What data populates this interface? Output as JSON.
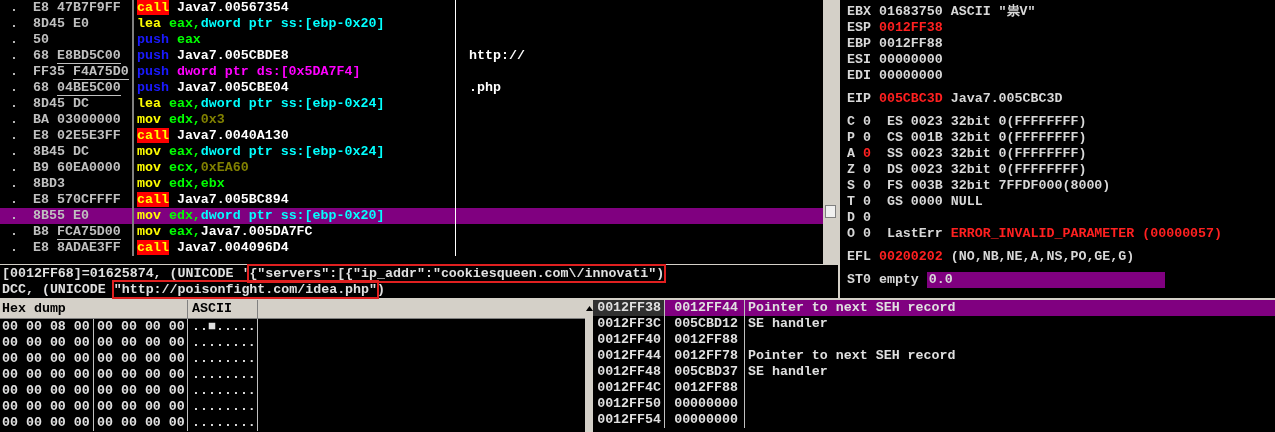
{
  "disassembly": {
    "rows": [
      {
        "marker": ".",
        "opcode": "E8",
        "operand": "47B7F9FF",
        "operand_underlined": false,
        "selected": false,
        "instruction": [
          {
            "text": "call",
            "kind": "call"
          },
          {
            "text": " Java7.00567354",
            "kind": "plain"
          }
        ]
      },
      {
        "marker": ".",
        "opcode": "8D45",
        "operand": "E0",
        "operand_underlined": false,
        "selected": false,
        "instruction": [
          {
            "text": "lea",
            "kind": "mnemonic"
          },
          {
            "text": " eax,",
            "kind": "register"
          },
          {
            "text": "dword ptr ss:[ebp-0x20]",
            "kind": "memory"
          }
        ]
      },
      {
        "marker": ".",
        "opcode": "50",
        "selected": false,
        "instruction": [
          {
            "text": "push",
            "kind": "stack"
          },
          {
            "text": " eax",
            "kind": "register"
          }
        ]
      },
      {
        "marker": ".",
        "opcode": "68",
        "operand": "E8BD5C00",
        "operand_underlined": true,
        "selected": false,
        "instruction": [
          {
            "text": "push",
            "kind": "stack"
          },
          {
            "text": " Java7.005CBDE8",
            "kind": "plain"
          }
        ],
        "comment": "http://"
      },
      {
        "marker": ".",
        "opcode": "FF35",
        "operand": "F4A75D0",
        "operand_underlined": true,
        "selected": false,
        "instruction": [
          {
            "text": "push",
            "kind": "stack"
          },
          {
            "text": " dword ptr ds:[0x5DA7F4]",
            "kind": "global"
          }
        ]
      },
      {
        "marker": ".",
        "opcode": "68",
        "operand": "04BE5C00",
        "operand_underlined": true,
        "selected": false,
        "instruction": [
          {
            "text": "push",
            "kind": "stack"
          },
          {
            "text": " Java7.005CBE04",
            "kind": "plain"
          }
        ],
        "comment": ".php"
      },
      {
        "marker": ".",
        "opcode": "8D45",
        "operand": "DC",
        "operand_underlined": false,
        "selected": false,
        "instruction": [
          {
            "text": "lea",
            "kind": "mnemonic"
          },
          {
            "text": " eax,",
            "kind": "register"
          },
          {
            "text": "dword ptr ss:[ebp-0x24]",
            "kind": "memory"
          }
        ]
      },
      {
        "marker": ".",
        "opcode": "BA",
        "operand": "03000000",
        "operand_underlined": false,
        "selected": false,
        "instruction": [
          {
            "text": "mov",
            "kind": "mnemonic"
          },
          {
            "text": " edx,",
            "kind": "register"
          },
          {
            "text": "0x3",
            "kind": "constant"
          }
        ]
      },
      {
        "marker": ".",
        "opcode": "E8",
        "operand": "02E5E3FF",
        "operand_underlined": false,
        "selected": false,
        "instruction": [
          {
            "text": "call",
            "kind": "call"
          },
          {
            "text": " Java7.0040A130",
            "kind": "plain"
          }
        ]
      },
      {
        "marker": ".",
        "opcode": "8B45",
        "operand": "DC",
        "operand_underlined": false,
        "selected": false,
        "instruction": [
          {
            "text": "mov",
            "kind": "mnemonic"
          },
          {
            "text": " eax,",
            "kind": "register"
          },
          {
            "text": "dword ptr ss:[ebp-0x24]",
            "kind": "memory"
          }
        ]
      },
      {
        "marker": ".",
        "opcode": "B9",
        "operand": "60EA0000",
        "operand_underlined": false,
        "selected": false,
        "instruction": [
          {
            "text": "mov",
            "kind": "mnemonic"
          },
          {
            "text": " ecx,",
            "kind": "register"
          },
          {
            "text": "0xEA60",
            "kind": "constant"
          }
        ]
      },
      {
        "marker": ".",
        "opcode": "8BD3",
        "selected": false,
        "instruction": [
          {
            "text": "mov",
            "kind": "mnemonic"
          },
          {
            "text": " edx,ebx",
            "kind": "register"
          }
        ]
      },
      {
        "marker": ".",
        "opcode": "E8",
        "operand": "570CFFFF",
        "operand_underlined": false,
        "selected": false,
        "instruction": [
          {
            "text": "call",
            "kind": "call"
          },
          {
            "text": " Java7.005BC894",
            "kind": "plain"
          }
        ]
      },
      {
        "marker": ".",
        "opcode": "8B55",
        "operand": "E0",
        "operand_underlined": false,
        "selected": true,
        "instruction": [
          {
            "text": "mov",
            "kind": "mnemonic"
          },
          {
            "text": " edx,",
            "kind": "register"
          },
          {
            "text": "dword ptr ss:[ebp-0x20]",
            "kind": "memory"
          }
        ]
      },
      {
        "marker": ".",
        "opcode": "B8",
        "operand": "FCA75D00",
        "operand_underlined": true,
        "selected": false,
        "instruction": [
          {
            "text": "mov",
            "kind": "mnemonic"
          },
          {
            "text": " eax,",
            "kind": "register"
          },
          {
            "text": "Java7.005DA7FC",
            "kind": "plain"
          }
        ]
      },
      {
        "marker": ".",
        "opcode": "E8",
        "operand": "8ADAE3FF",
        "operand_underlined": false,
        "selected": false,
        "instruction": [
          {
            "text": "call",
            "kind": "call"
          },
          {
            "text": " Java7.004096D4",
            "kind": "plain"
          }
        ]
      }
    ]
  },
  "registers": {
    "groups": [
      [
        [
          {
            "text": "EBX 01683750 ASCII \"祟V\"",
            "changed": false
          }
        ],
        [
          {
            "text": "ESP ",
            "changed": false
          },
          {
            "text": "0012FF38",
            "changed": true
          }
        ],
        [
          {
            "text": "EBP 0012FF88",
            "changed": false
          }
        ],
        [
          {
            "text": "ESI 00000000",
            "changed": false
          }
        ],
        [
          {
            "text": "EDI 00000000",
            "changed": false
          }
        ]
      ],
      [
        [
          {
            "text": "EIP ",
            "changed": false
          },
          {
            "text": "005CBC3D",
            "changed": true
          },
          {
            "text": " Java7.005CBC3D",
            "changed": false
          }
        ]
      ],
      [
        [
          {
            "text": "C 0  ES 0023 32bit 0(FFFFFFFF)",
            "changed": false
          }
        ],
        [
          {
            "text": "P 0  CS 001B 32bit 0(FFFFFFFF)",
            "changed": false
          }
        ],
        [
          {
            "text": "A ",
            "changed": false
          },
          {
            "text": "0",
            "changed": true
          },
          {
            "text": "  SS 0023 32bit 0(FFFFFFFF)",
            "changed": false
          }
        ],
        [
          {
            "text": "Z 0  DS 0023 32bit 0(FFFFFFFF)",
            "changed": false
          }
        ],
        [
          {
            "text": "S 0  FS 003B 32bit 7FFDF000(8000)",
            "changed": false
          }
        ],
        [
          {
            "text": "T 0  GS 0000 NULL",
            "changed": false
          }
        ],
        [
          {
            "text": "D 0",
            "changed": false
          }
        ],
        [
          {
            "text": "O 0  LastErr ",
            "changed": false
          },
          {
            "text": "ERROR_INVALID_PARAMETER (00000057)",
            "changed": true
          }
        ]
      ],
      [
        [
          {
            "text": "EFL ",
            "changed": false
          },
          {
            "text": "00200202",
            "changed": true
          },
          {
            "text": " (NO,NB,NE,A,NS,PO,GE,G)",
            "changed": false
          }
        ]
      ]
    ],
    "fpu": [
      {
        "name": "ST0",
        "tag": "empty",
        "value": "0.0",
        "selected": true
      }
    ]
  },
  "info": {
    "lines": [
      [
        {
          "text": "[0012FF68]=01625874, (UNICODE '",
          "boxed": false
        },
        {
          "text": "{\"servers\":[{\"ip_addr\":\"cookiesqueen.com\\/innovati\")",
          "boxed": true
        }
      ],
      [
        {
          "text": "DCC, (UNICODE ",
          "boxed": false
        },
        {
          "text": "\"http://poisonfight.com/idea.php\"",
          "boxed": true
        },
        {
          "text": ")",
          "boxed": false
        }
      ]
    ]
  },
  "hex_dump": {
    "columns": [
      "Hex dump",
      "ASCII"
    ],
    "rows": [
      {
        "bytes_1": "00 00 08 00",
        "bytes_2": "00 00 00 00",
        "ascii": "..■....."
      },
      {
        "bytes_1": "00 00 00 00",
        "bytes_2": "00 00 00 00",
        "ascii": "........"
      },
      {
        "bytes_1": "00 00 00 00",
        "bytes_2": "00 00 00 00",
        "ascii": "........"
      },
      {
        "bytes_1": "00 00 00 00",
        "bytes_2": "00 00 00 00",
        "ascii": "........"
      },
      {
        "bytes_1": "00 00 00 00",
        "bytes_2": "00 00 00 00",
        "ascii": "........"
      },
      {
        "bytes_1": "00 00 00 00",
        "bytes_2": "00 00 00 00",
        "ascii": "........"
      },
      {
        "bytes_1": "00 00 00 00",
        "bytes_2": "00 00 00 00",
        "ascii": "........"
      }
    ]
  },
  "stack": {
    "rows": [
      {
        "address": "0012FF38",
        "value": "0012FF44",
        "comment": "Pointer to next SEH record",
        "selected": true
      },
      {
        "address": "0012FF3C",
        "value": "005CBD12",
        "comment": "SE handler",
        "selected": false
      },
      {
        "address": "0012FF40",
        "value": "0012FF88",
        "selected": false
      },
      {
        "address": "0012FF44",
        "value": "0012FF78",
        "comment": "Pointer to next SEH record",
        "selected": false
      },
      {
        "address": "0012FF48",
        "value": "005CBD37",
        "comment": "SE handler",
        "selected": false
      },
      {
        "address": "0012FF4C",
        "value": "0012FF88",
        "selected": false
      },
      {
        "address": "0012FF50",
        "value": "00000000",
        "selected": false
      },
      {
        "address": "0012FF54",
        "value": "00000000",
        "selected": false
      }
    ]
  }
}
